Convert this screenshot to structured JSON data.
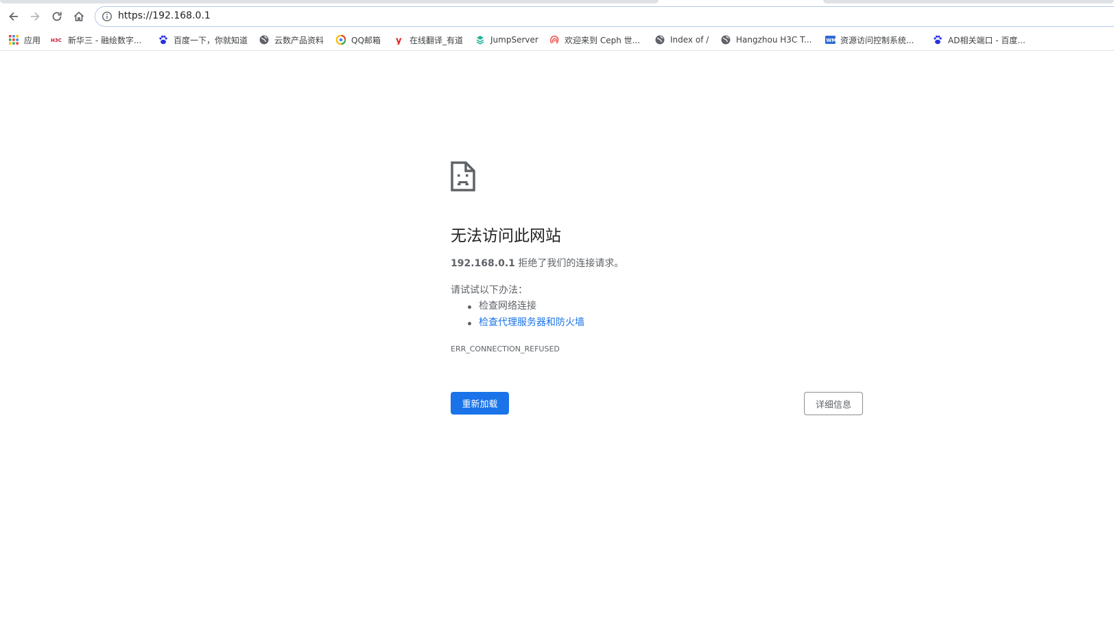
{
  "browser": {
    "url": "https://192.168.0.1"
  },
  "bookmarks": [
    {
      "label": "应用",
      "icon": "apps-grid-icon"
    },
    {
      "label": "新华三 - 融绘数字...",
      "icon": "h3c-logo-icon"
    },
    {
      "label": "百度一下，你就知道",
      "icon": "baidu-paw-icon"
    },
    {
      "label": "云数产品资料",
      "icon": "globe-icon"
    },
    {
      "label": "QQ邮箱",
      "icon": "qq-mail-icon"
    },
    {
      "label": "在线翻译_有道",
      "icon": "youdao-icon"
    },
    {
      "label": "JumpServer",
      "icon": "jumpserver-icon"
    },
    {
      "label": "欢迎来到 Ceph 世...",
      "icon": "ceph-icon"
    },
    {
      "label": "Index of /",
      "icon": "globe-icon"
    },
    {
      "label": "Hangzhou H3C T...",
      "icon": "globe-icon"
    },
    {
      "label": "资源访问控制系统...",
      "icon": "wm-icon"
    },
    {
      "label": "AD相关端口 - 百度...",
      "icon": "baidu-paw-icon"
    }
  ],
  "error": {
    "title": "无法访问此网站",
    "host": "192.168.0.1",
    "message_rest": " 拒绝了我们的连接请求。",
    "try_label": "请试试以下办法：",
    "suggestions": [
      {
        "text": "检查网络连接",
        "link": false
      },
      {
        "text": "检查代理服务器和防火墙",
        "link": true
      }
    ],
    "code": "ERR_CONNECTION_REFUSED",
    "reload_label": "重新加载",
    "details_label": "详细信息"
  },
  "colors": {
    "accent": "#1a73e8",
    "text": "#202124",
    "secondary_text": "#5f6368"
  }
}
